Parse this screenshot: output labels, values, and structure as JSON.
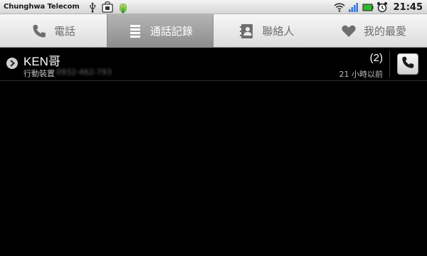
{
  "status_bar": {
    "carrier": "Chunghwa Telecom",
    "time": "21:45",
    "notification_icons": [
      "usb-icon",
      "market-icon",
      "android-download-icon"
    ],
    "system_icons": [
      "wifi-icon",
      "signal-icon",
      "battery-icon",
      "alarm-icon"
    ]
  },
  "tabs": [
    {
      "label": "電話",
      "icon": "phone-icon",
      "active": false
    },
    {
      "label": "通話記錄",
      "icon": "call-log-icon",
      "active": true
    },
    {
      "label": "聯絡人",
      "icon": "contacts-icon",
      "active": false
    },
    {
      "label": "我的最愛",
      "icon": "heart-icon",
      "active": false
    }
  ],
  "call_log": [
    {
      "name": "KEN哥",
      "number_type": "行動裝置",
      "number": "0932-462-793",
      "count": "(2)",
      "time_ago": "21 小時以前"
    }
  ],
  "colors": {
    "active_tab": "#9e9e9e",
    "background": "#000000",
    "battery": "#2fb82f",
    "signal": "#3b78d8"
  }
}
